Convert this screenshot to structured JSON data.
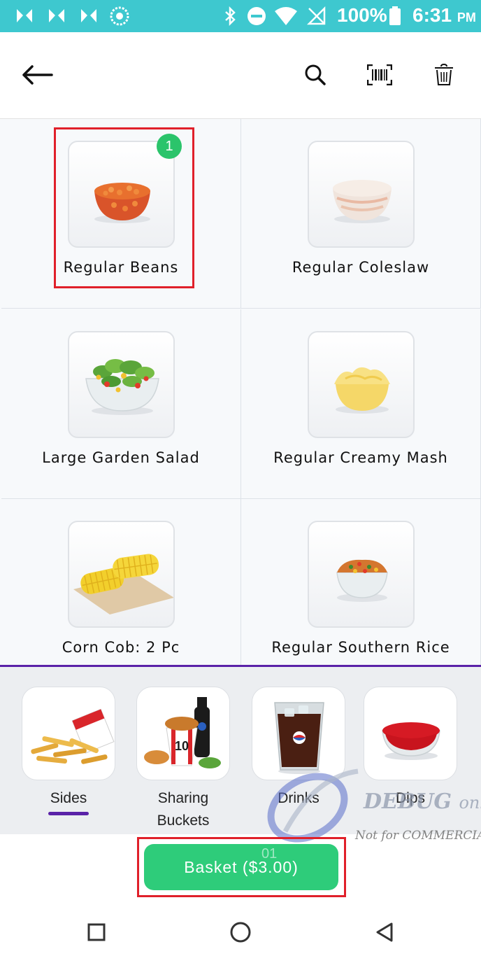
{
  "status_bar": {
    "battery": "100%",
    "time": "6:31",
    "ampm": "PM",
    "icons": [
      "app-notification-icon",
      "app-notification-icon",
      "app-notification-icon",
      "pinwheel-icon",
      "bluetooth-icon",
      "do-not-disturb-icon",
      "wifi-icon",
      "no-sim-icon",
      "battery-full-icon"
    ]
  },
  "app_bar": {
    "icons": [
      "back-arrow-icon",
      "search-icon",
      "barcode-scan-icon",
      "trash-icon"
    ]
  },
  "products": [
    {
      "label": "Regular Beans",
      "quantity": "1",
      "icon": "beans-bowl-image"
    },
    {
      "label": "Regular Coleslaw",
      "icon": "coleslaw-bowl-image"
    },
    {
      "label": "Large Garden Salad",
      "icon": "salad-bowl-image"
    },
    {
      "label": "Regular Creamy Mash",
      "icon": "mash-bowl-image"
    },
    {
      "label": "Corn Cob: 2 Pc",
      "icon": "corn-cob-image"
    },
    {
      "label": "Regular Southern Rice",
      "icon": "rice-bowl-image"
    }
  ],
  "categories": [
    {
      "label": "Sides",
      "selected": true,
      "icon": "fries-image"
    },
    {
      "label": "Sharing Buckets",
      "selected": false,
      "icon": "bucket-image"
    },
    {
      "label": "Drinks",
      "selected": false,
      "icon": "drink-cup-image"
    },
    {
      "label": "Dips",
      "selected": false,
      "icon": "dip-bowl-image"
    }
  ],
  "basket": {
    "label": "Basket ($3.00)",
    "overlay": "01"
  },
  "watermark": {
    "line1": "DEBUG",
    "line1b": "only",
    "line2": "Not for COMMERCIAL"
  },
  "nav_bar": {
    "icons": [
      "recents-square-icon",
      "home-circle-icon",
      "back-triangle-icon"
    ]
  },
  "colors": {
    "status_bar": "#3ec8cf",
    "accent_purple": "#5a22a8",
    "basket_green": "#2ecc7a",
    "badge_green": "#2bc46b",
    "highlight_red": "#e0202a"
  }
}
